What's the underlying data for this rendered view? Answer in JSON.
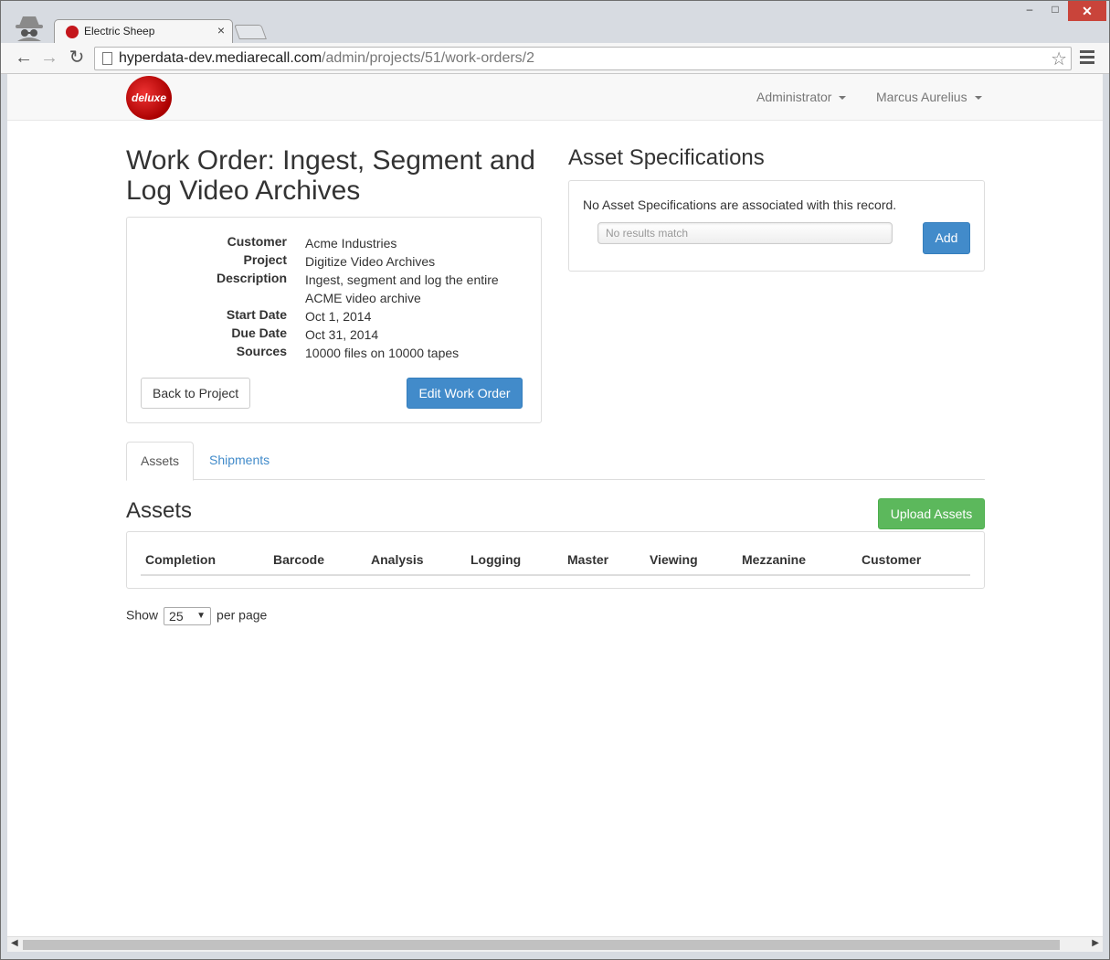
{
  "browser": {
    "tab_title": "Electric Sheep",
    "tab_close": "×",
    "url_host": "hyperdata-dev.mediarecall.com",
    "url_path": "/admin/projects/51/work-orders/2",
    "window_buttons": {
      "minimize": "–",
      "maximize": "□",
      "close": "✕"
    },
    "nav": {
      "back": "←",
      "forward": "→",
      "reload": "↻"
    },
    "star_icon": "☆"
  },
  "navbar": {
    "logo_text": "deluxe",
    "admin_menu": "Administrator",
    "user_menu": "Marcus Aurelius"
  },
  "work_order": {
    "title": "Work Order: Ingest, Segment and Log Video Archives",
    "fields": [
      {
        "label": "Customer",
        "value": "Acme Industries"
      },
      {
        "label": "Project",
        "value": "Digitize Video Archives"
      },
      {
        "label": "Description",
        "value": "Ingest, segment and log the entire ACME video archive"
      },
      {
        "label": "Start Date",
        "value": "Oct 1, 2014"
      },
      {
        "label": "Due Date",
        "value": "Oct 31, 2014"
      },
      {
        "label": "Sources",
        "value": "10000 files on 10000 tapes"
      }
    ],
    "back_button": "Back to Project",
    "edit_button": "Edit Work Order"
  },
  "asset_specs": {
    "title": "Asset Specifications",
    "empty_message": "No Asset Specifications are associated with this record.",
    "select_placeholder": "No results match",
    "add_button": "Add"
  },
  "tabs": [
    {
      "label": "Assets",
      "active": true
    },
    {
      "label": "Shipments",
      "active": false
    }
  ],
  "assets": {
    "title": "Assets",
    "upload_button": "Upload Assets",
    "columns": [
      "Completion",
      "Barcode",
      "Analysis",
      "Logging",
      "Master",
      "Viewing",
      "Mezzanine",
      "Customer"
    ]
  },
  "pager": {
    "show_label": "Show",
    "page_size": "25",
    "per_page_label": "per page"
  },
  "colors": {
    "primary": "#428bca",
    "success": "#5cb85c",
    "brand_red": "#c4161c"
  }
}
